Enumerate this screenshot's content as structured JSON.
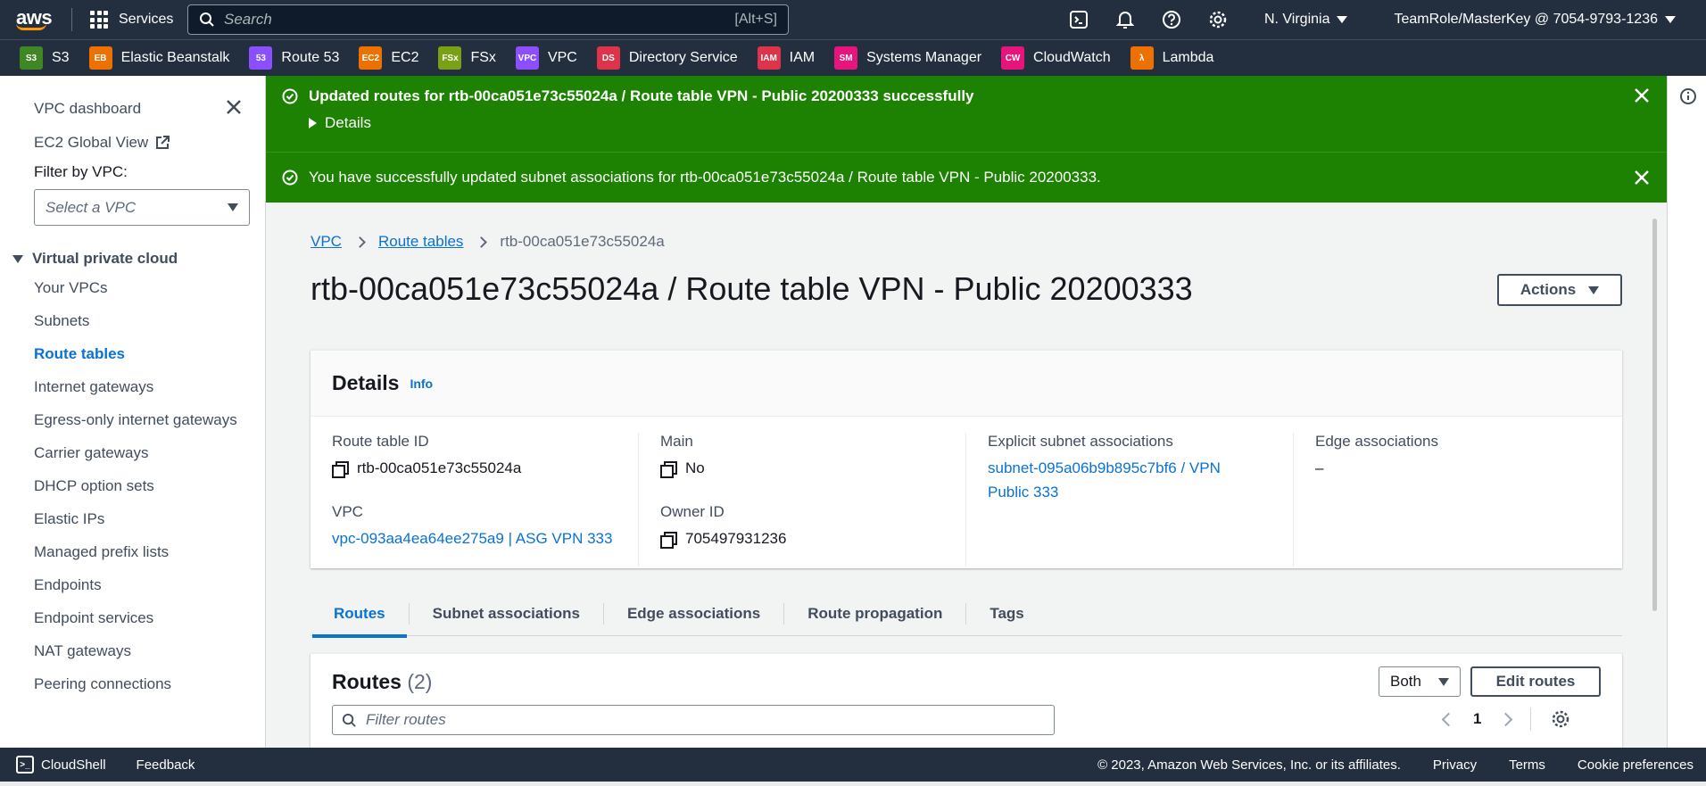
{
  "topbar": {
    "logo": "aws",
    "services_label": "Services",
    "search_placeholder": "Search",
    "search_shortcut": "[Alt+S]",
    "region": "N. Virginia",
    "account": "TeamRole/MasterKey @ 7054-9793-1236"
  },
  "favorites": [
    {
      "label": "S3",
      "icon": "s3-icon",
      "color": "#3f8624",
      "glyph": "S3"
    },
    {
      "label": "Elastic Beanstalk",
      "icon": "elastic-beanstalk-icon",
      "color": "#ed7100",
      "glyph": "EB"
    },
    {
      "label": "Route 53",
      "icon": "route53-icon",
      "color": "#8c4fff",
      "glyph": "53"
    },
    {
      "label": "EC2",
      "icon": "ec2-icon",
      "color": "#ed7100",
      "glyph": "EC2"
    },
    {
      "label": "FSx",
      "icon": "fsx-icon",
      "color": "#7aa116",
      "glyph": "FSx"
    },
    {
      "label": "VPC",
      "icon": "vpc-icon",
      "color": "#8c4fff",
      "glyph": "VPC"
    },
    {
      "label": "Directory Service",
      "icon": "directory-service-icon",
      "color": "#dd344c",
      "glyph": "DS"
    },
    {
      "label": "IAM",
      "icon": "iam-icon",
      "color": "#dd344c",
      "glyph": "IAM"
    },
    {
      "label": "Systems Manager",
      "icon": "systems-manager-icon",
      "color": "#e7157b",
      "glyph": "SM"
    },
    {
      "label": "CloudWatch",
      "icon": "cloudwatch-icon",
      "color": "#e7157b",
      "glyph": "CW"
    },
    {
      "label": "Lambda",
      "icon": "lambda-icon",
      "color": "#ed7100",
      "glyph": "λ"
    }
  ],
  "sidebar": {
    "vpc_dashboard": "VPC dashboard",
    "ec2_global_view": "EC2 Global View",
    "filter_label": "Filter by VPC:",
    "filter_placeholder": "Select a VPC",
    "section": "Virtual private cloud",
    "items": [
      "Your VPCs",
      "Subnets",
      "Route tables",
      "Internet gateways",
      "Egress-only internet gateways",
      "Carrier gateways",
      "DHCP option sets",
      "Elastic IPs",
      "Managed prefix lists",
      "Endpoints",
      "Endpoint services",
      "NAT gateways",
      "Peering connections"
    ],
    "active_item": "Route tables"
  },
  "flash": {
    "msg1": "Updated routes for rtb-00ca051e73c55024a / Route table VPN - Public 20200333 successfully",
    "details": "Details",
    "msg2": "You have successfully updated subnet associations for rtb-00ca051e73c55024a / Route table VPN - Public 20200333.",
    "color": "#1d8102"
  },
  "breadcrumb": {
    "vpc": "VPC",
    "route_tables": "Route tables",
    "current": "rtb-00ca051e73c55024a"
  },
  "page_title": "rtb-00ca051e73c55024a / Route table VPN - Public 20200333",
  "actions_label": "Actions",
  "details": {
    "title": "Details",
    "info": "Info",
    "route_table_id_label": "Route table ID",
    "route_table_id": "rtb-00ca051e73c55024a",
    "vpc_label": "VPC",
    "vpc": "vpc-093aa4ea64ee275a9 | ASG VPN 333",
    "main_label": "Main",
    "main": "No",
    "owner_label": "Owner ID",
    "owner": "705497931236",
    "explicit_label": "Explicit subnet associations",
    "explicit": "subnet-095a06b9b895c7bf6 / VPN Public 333",
    "edge_label": "Edge associations",
    "edge": "–"
  },
  "tabs": [
    "Routes",
    "Subnet associations",
    "Edge associations",
    "Route propagation",
    "Tags"
  ],
  "routes": {
    "title": "Routes",
    "count": "(2)",
    "filter_value": "Both",
    "edit_label": "Edit routes",
    "filter_placeholder": "Filter routes",
    "page": "1"
  },
  "footer": {
    "cloudshell": "CloudShell",
    "feedback": "Feedback",
    "copyright": "© 2023, Amazon Web Services, Inc. or its affiliates.",
    "privacy": "Privacy",
    "terms": "Terms",
    "cookies": "Cookie preferences"
  }
}
